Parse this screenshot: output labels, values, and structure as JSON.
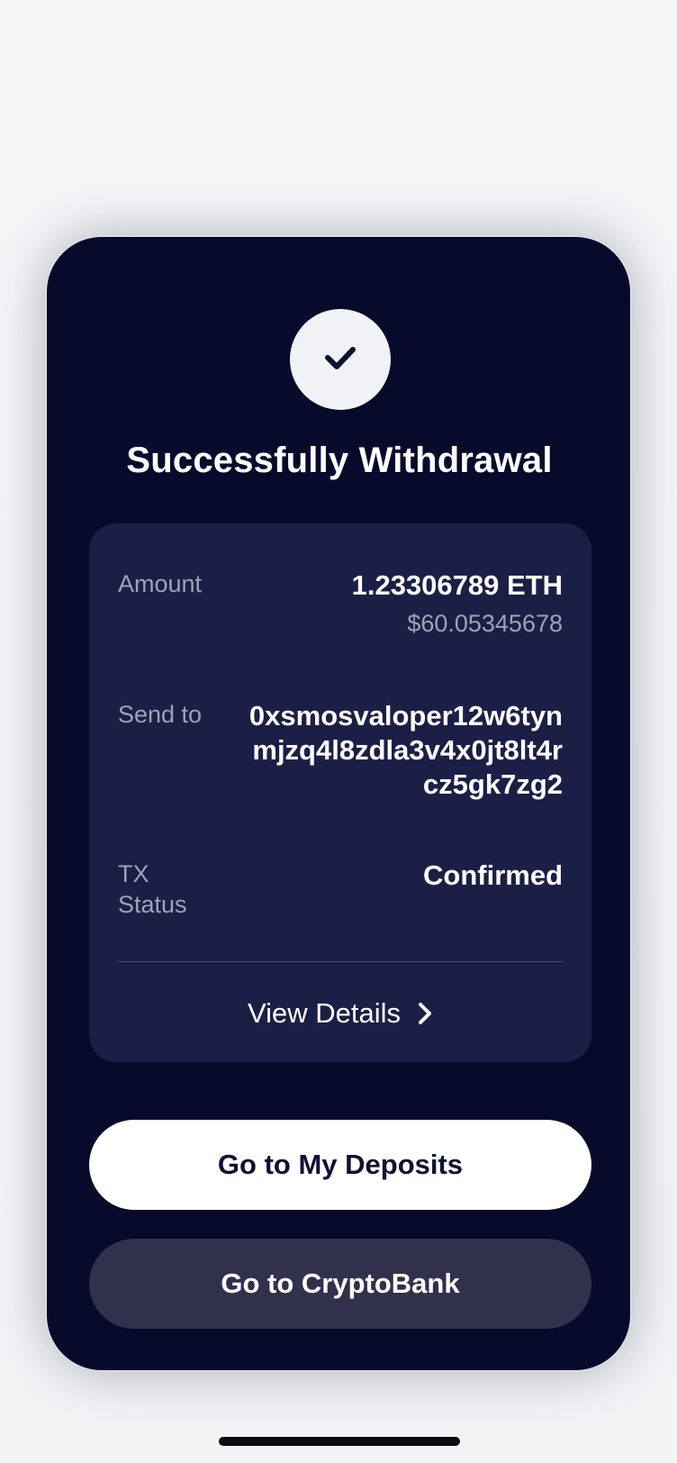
{
  "success": {
    "title": "Successfully Withdrawal",
    "icon": "check-icon"
  },
  "details": {
    "amount_label": "Amount",
    "amount_value": "1.23306789 ETH",
    "amount_fiat": "$60.05345678",
    "send_to_label": "Send to",
    "send_to_value": "0xsmosvaloper12w6tynmjzq4l8zdla3v4x0jt8lt4rcz5gk7zg2",
    "status_label": "TX Status",
    "status_value": "Confirmed",
    "view_details_label": "View Details"
  },
  "actions": {
    "primary_label": "Go to My Deposits",
    "secondary_label": "Go to CryptoBank"
  },
  "colors": {
    "card_background": "#080a2c",
    "panel_background": "#1c1f45",
    "secondary_button": "#31314d",
    "muted_text": "#9ea1b8"
  }
}
